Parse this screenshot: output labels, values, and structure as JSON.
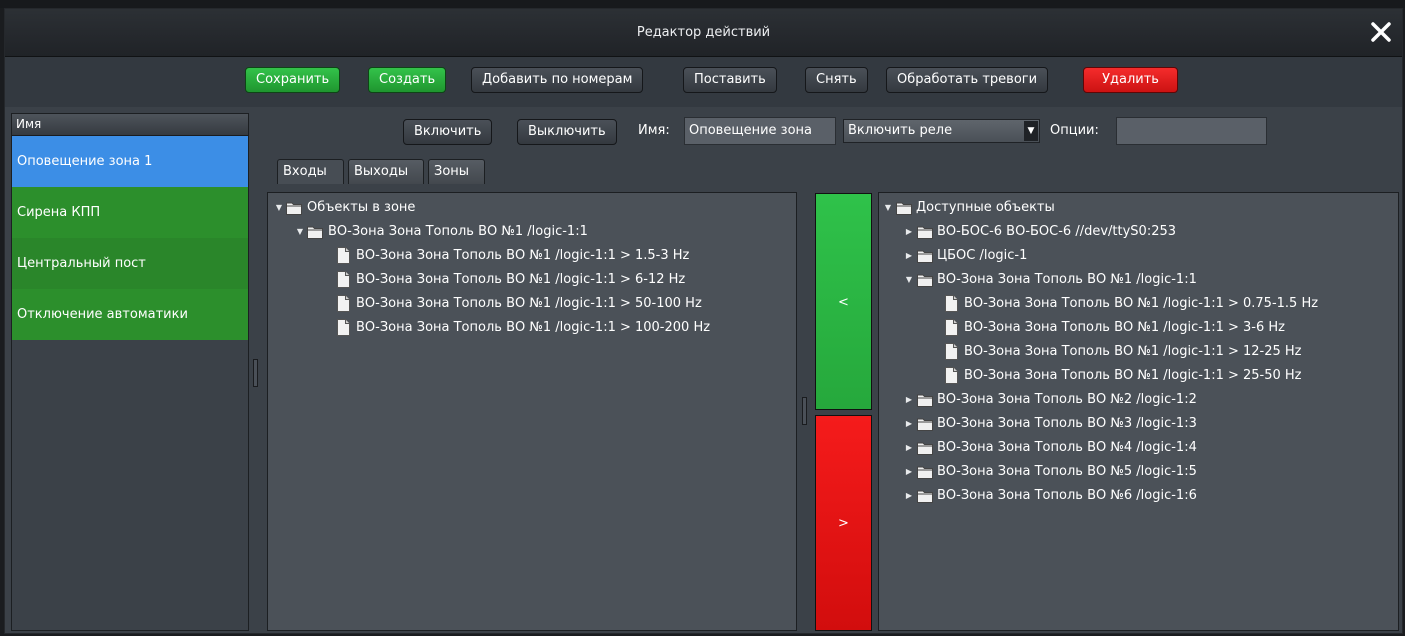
{
  "window": {
    "title": "Редактор действий",
    "close_icon": "close-icon"
  },
  "toolbar": {
    "save": "Сохранить",
    "create": "Создать",
    "add_by_numbers": "Добавить по номерам",
    "arm": "Поставить",
    "disarm": "Снять",
    "process_alarms": "Обработать тревоги",
    "delete": "Удалить"
  },
  "sidebar": {
    "header": "Имя",
    "items": [
      {
        "label": "Оповещение зона 1"
      },
      {
        "label": "Сирена КПП"
      },
      {
        "label": "Центральный пост"
      },
      {
        "label": "Отключение автоматики"
      }
    ]
  },
  "action": {
    "enable": "Включить",
    "disable": "Выключить",
    "name_label": "Имя:",
    "name_value": "Оповещение зона",
    "action_select": "Включить реле",
    "options_label": "Опции:",
    "options_value": ""
  },
  "tabs": [
    "Входы",
    "Выходы",
    "Зоны"
  ],
  "left_tree": {
    "root": "Объекты в зоне",
    "group": "ВО-Зона Зона Тополь ВО №1 /logic-1:1",
    "items": [
      "ВО-Зона Зона Тополь ВО №1 /logic-1:1 > 1.5-3 Hz",
      "ВО-Зона Зона Тополь ВО №1 /logic-1:1 > 6-12 Hz",
      "ВО-Зона Зона Тополь ВО №1 /logic-1:1 > 50-100 Hz",
      "ВО-Зона Зона Тополь ВО №1 /logic-1:1 > 100-200 Hz"
    ]
  },
  "move_buttons": {
    "add": "<",
    "remove": ">"
  },
  "right_tree": {
    "root": "Доступные объекты",
    "groups_before": [
      "ВО-БОС-6 ВО-БОС-6 //dev/ttyS0:253",
      "ЦБОС  /logic-1"
    ],
    "expanded_group": "ВО-Зона Зона Тополь ВО №1 /logic-1:1",
    "expanded_items": [
      "ВО-Зона Зона Тополь ВО №1 /logic-1:1 > 0.75-1.5 Hz",
      "ВО-Зона Зона Тополь ВО №1 /logic-1:1 > 3-6 Hz",
      "ВО-Зона Зона Тополь ВО №1 /logic-1:1 > 12-25 Hz",
      "ВО-Зона Зона Тополь ВО №1 /logic-1:1 > 25-50 Hz"
    ],
    "groups_after": [
      "ВО-Зона Зона Тополь ВО №2 /logic-1:2",
      "ВО-Зона Зона Тополь ВО №3 /logic-1:3",
      "ВО-Зона Зона Тополь ВО №4 /logic-1:4",
      "ВО-Зона Зона Тополь ВО №5 /logic-1:5",
      "ВО-Зона Зона Тополь ВО №6 /logic-1:6"
    ]
  },
  "colors": {
    "window_bg": "#3b4148",
    "panel_bg": "#4b5158",
    "green_button": "#2ab43e",
    "red_button": "#e61414",
    "selected_item": "#3c8ee6",
    "list_item_green": "#2c8f2c"
  }
}
